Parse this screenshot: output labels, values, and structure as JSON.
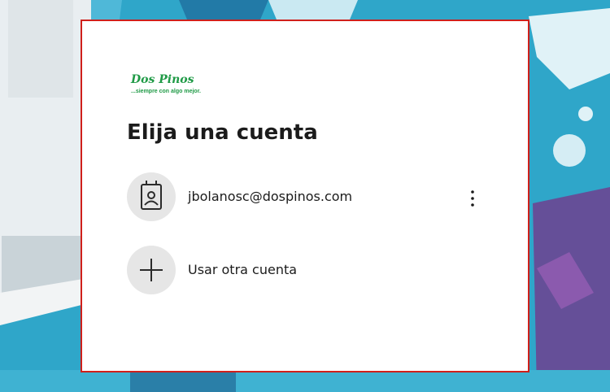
{
  "background": {
    "primary_color": "#2fa6c9",
    "accent_color": "#6e3f8f"
  },
  "dialog": {
    "border_color": "#d0201b",
    "logo": {
      "brand": "Dos Pinos",
      "tagline": "...siempre con algo mejor."
    },
    "title": "Elija una cuenta",
    "accounts": [
      {
        "email": "jbolanosc@dospinos.com",
        "icon": "person-badge-icon"
      }
    ],
    "other_account_label": "Usar otra cuenta",
    "other_account_icon": "plus-icon",
    "more_options_icon": "more-options-icon"
  }
}
